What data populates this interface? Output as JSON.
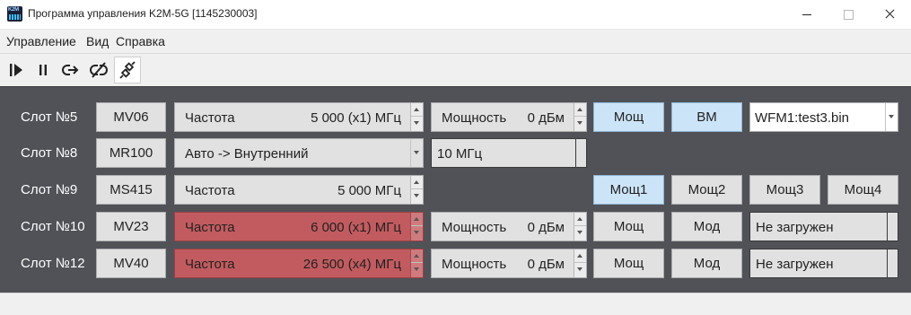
{
  "window": {
    "title": "Программа управления K2M-5G [1145230003]",
    "icon_text": "K2M"
  },
  "menu": [
    "Управление",
    "Вид",
    "Справка"
  ],
  "toolbar": {
    "buttons": [
      {
        "icon": "play-step-icon"
      },
      {
        "icon": "pause-icon"
      },
      {
        "icon": "connect-arrow-icon"
      },
      {
        "icon": "disconnect-icon"
      },
      {
        "icon": "plug-icon",
        "active": true
      }
    ]
  },
  "colors": {
    "panel_bg": "#505257",
    "button_bg": "#e1e1e1",
    "button_active_bg": "#cce4f7",
    "alert_bg": "#c25b5f"
  },
  "slots": [
    {
      "label": "Слот №5",
      "module": "MV06",
      "freq": {
        "label": "Частота",
        "value": "5 000 (x1) МГц",
        "alert": false
      },
      "power": {
        "label": "Мощность",
        "value": "0 дБм"
      },
      "buttons": [
        {
          "label": "Мощ",
          "active": true
        },
        {
          "label": "ВМ",
          "active": true
        }
      ],
      "waveform": {
        "value": "WFM1:test3.bin"
      }
    },
    {
      "label": "Слот №8",
      "module": "MR100",
      "source": {
        "value": "Авто -> Внутренний"
      },
      "ref": {
        "value": "10 МГц"
      }
    },
    {
      "label": "Слот №9",
      "module": "MS415",
      "freq": {
        "label": "Частота",
        "value": "5 000 МГц",
        "alert": false
      },
      "buttons": [
        {
          "label": "Мощ1",
          "active": true
        },
        {
          "label": "Мощ2",
          "active": false
        },
        {
          "label": "Мощ3",
          "active": false
        },
        {
          "label": "Мощ4",
          "active": false
        }
      ]
    },
    {
      "label": "Слот №10",
      "module": "MV23",
      "freq": {
        "label": "Частота",
        "value": "6 000 (x1) МГц",
        "alert": true
      },
      "power": {
        "label": "Мощность",
        "value": "0 дБм"
      },
      "buttons": [
        {
          "label": "Мощ",
          "active": false
        },
        {
          "label": "Мод",
          "active": false
        }
      ],
      "status": {
        "value": "Не загружен"
      }
    },
    {
      "label": "Слот №12",
      "module": "MV40",
      "freq": {
        "label": "Частота",
        "value": "26 500 (x4) МГц",
        "alert": true
      },
      "power": {
        "label": "Мощность",
        "value": "0 дБм"
      },
      "buttons": [
        {
          "label": "Мощ",
          "active": false
        },
        {
          "label": "Мод",
          "active": false
        }
      ],
      "status": {
        "value": "Не загружен"
      }
    }
  ]
}
